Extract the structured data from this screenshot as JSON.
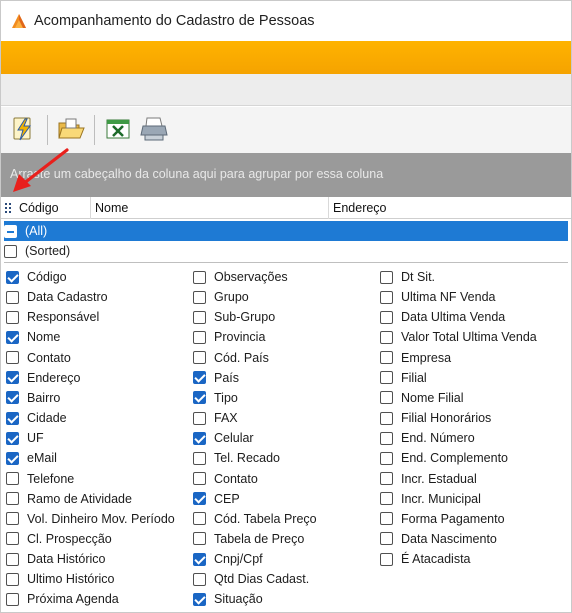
{
  "window": {
    "title": "Acompanhamento do Cadastro de Pessoas"
  },
  "toolbar": {
    "buttons": [
      {
        "name": "refresh-lightning-button",
        "icon": "lightning-doc-icon"
      },
      {
        "name": "open-folder-button",
        "icon": "folder-open-icon"
      },
      {
        "name": "excel-export-button",
        "icon": "excel-icon"
      },
      {
        "name": "print-button",
        "icon": "printer-icon"
      }
    ]
  },
  "group_panel": {
    "text": "Arraste um cabeçalho da coluna aqui para agrupar por essa coluna"
  },
  "columns": [
    "Código",
    "Nome",
    "Endereço"
  ],
  "filter": {
    "all_label": "(All)",
    "sorted_label": "(Sorted)",
    "columns": [
      [
        {
          "label": "Código",
          "checked": true
        },
        {
          "label": "Data Cadastro",
          "checked": false
        },
        {
          "label": "Responsável",
          "checked": false
        },
        {
          "label": "Nome",
          "checked": true
        },
        {
          "label": "Contato",
          "checked": false
        },
        {
          "label": "Endereço",
          "checked": true
        },
        {
          "label": "Bairro",
          "checked": true
        },
        {
          "label": "Cidade",
          "checked": true
        },
        {
          "label": "UF",
          "checked": true
        },
        {
          "label": "eMail",
          "checked": true
        },
        {
          "label": "Telefone",
          "checked": false
        },
        {
          "label": "Ramo de Atividade",
          "checked": false
        },
        {
          "label": "Vol. Dinheiro Mov. Período",
          "checked": false
        },
        {
          "label": "Cl. Prospecção",
          "checked": false
        },
        {
          "label": "Data Histórico",
          "checked": false
        },
        {
          "label": "Ultimo Histórico",
          "checked": false
        },
        {
          "label": "Próxima Agenda",
          "checked": false
        }
      ],
      [
        {
          "label": "Observações",
          "checked": false
        },
        {
          "label": "Grupo",
          "checked": false
        },
        {
          "label": "Sub-Grupo",
          "checked": false
        },
        {
          "label": "Provincia",
          "checked": false
        },
        {
          "label": "Cód. País",
          "checked": false
        },
        {
          "label": "País",
          "checked": true
        },
        {
          "label": "Tipo",
          "checked": true
        },
        {
          "label": "FAX",
          "checked": false
        },
        {
          "label": "Celular",
          "checked": true
        },
        {
          "label": "Tel. Recado",
          "checked": false
        },
        {
          "label": "Contato",
          "checked": false
        },
        {
          "label": "CEP",
          "checked": true
        },
        {
          "label": "Cód. Tabela Preço",
          "checked": false
        },
        {
          "label": "Tabela de Preço",
          "checked": false
        },
        {
          "label": "Cnpj/Cpf",
          "checked": true
        },
        {
          "label": "Qtd Dias Cadast.",
          "checked": false
        },
        {
          "label": "Situação",
          "checked": true
        }
      ],
      [
        {
          "label": "Dt Sit.",
          "checked": false
        },
        {
          "label": "Ultima NF Venda",
          "checked": false
        },
        {
          "label": "Data Ultima Venda",
          "checked": false
        },
        {
          "label": "Valor Total Ultima Venda",
          "checked": false
        },
        {
          "label": "Empresa",
          "checked": false
        },
        {
          "label": "Filial",
          "checked": false
        },
        {
          "label": "Nome Filial",
          "checked": false
        },
        {
          "label": "Filial Honorários",
          "checked": false
        },
        {
          "label": "End. Número",
          "checked": false
        },
        {
          "label": "End. Complemento",
          "checked": false
        },
        {
          "label": "Incr. Estadual",
          "checked": false
        },
        {
          "label": "Incr. Municipal",
          "checked": false
        },
        {
          "label": "Forma Pagamento",
          "checked": false
        },
        {
          "label": "Data Nascimento",
          "checked": false
        },
        {
          "label": "É Atacadista",
          "checked": false
        }
      ]
    ]
  }
}
